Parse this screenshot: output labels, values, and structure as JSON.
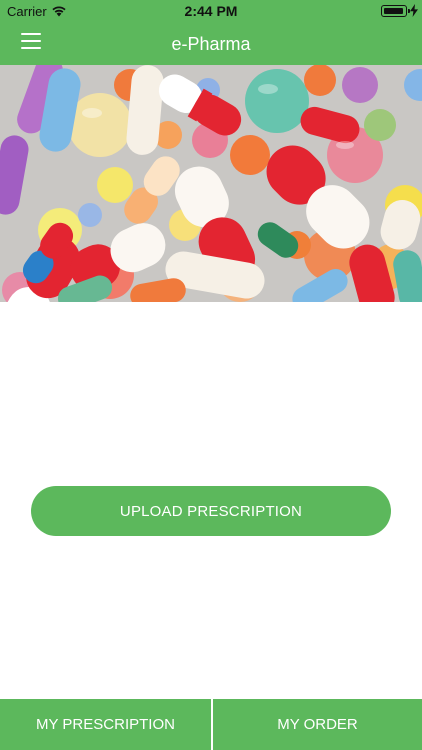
{
  "status_bar": {
    "carrier": "Carrier",
    "time": "2:44 PM",
    "battery_level": 0.95,
    "icons": [
      "wifi-icon",
      "battery-icon",
      "charging-bolt-icon"
    ]
  },
  "nav": {
    "title": "e-Pharma",
    "menu_icon": "hamburger-menu-icon"
  },
  "hero": {
    "image": "assorted-pills-photo"
  },
  "actions": {
    "upload_label": "UPLOAD PRESCRIPTION"
  },
  "tabs": [
    {
      "label": "MY PRESCRIPTION"
    },
    {
      "label": "MY ORDER"
    }
  ],
  "colors": {
    "primary": "#5cb85c",
    "text_on_primary": "#ffffff",
    "background": "#ffffff"
  }
}
